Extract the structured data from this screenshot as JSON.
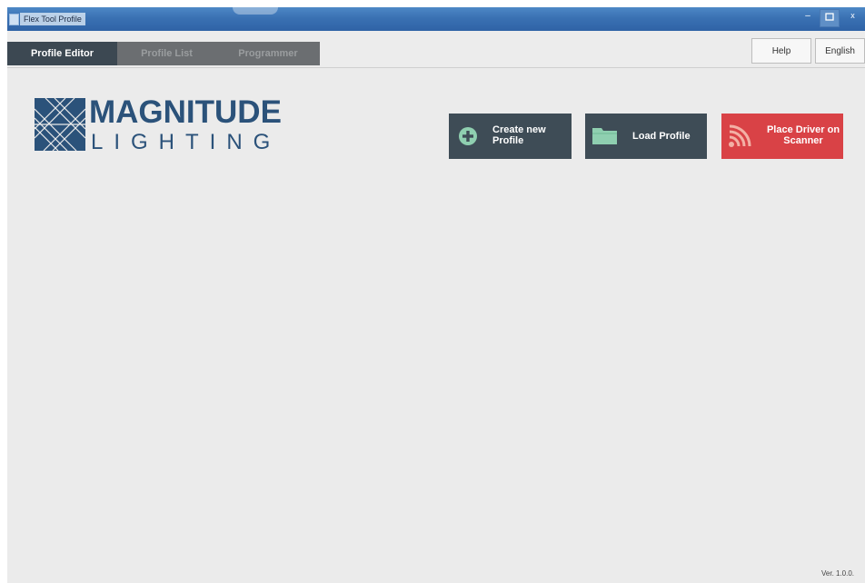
{
  "window": {
    "title": "Flex Tool Profile",
    "controls": {
      "minimize": "–",
      "maximize": "□",
      "close": "x"
    }
  },
  "tabs": [
    {
      "label": "Profile Editor",
      "active": true
    },
    {
      "label": "Profile List",
      "active": false
    },
    {
      "label": "Programmer",
      "active": false
    }
  ],
  "header": {
    "help_label": "Help",
    "language_label": "English"
  },
  "logo": {
    "line1": "MAGNITUDE",
    "line2": "LIGHTING"
  },
  "actions": {
    "create": {
      "label": "Create new Profile",
      "icon": "plus-circle-icon",
      "color": "#3e4c56"
    },
    "load": {
      "label": "Load Profile",
      "icon": "folder-icon",
      "color": "#3e4c56"
    },
    "place": {
      "label": "Place Driver on Scanner",
      "icon": "wireless-icon",
      "color": "#d94246"
    }
  },
  "footer": {
    "version": "Ver. 1.0.0."
  }
}
